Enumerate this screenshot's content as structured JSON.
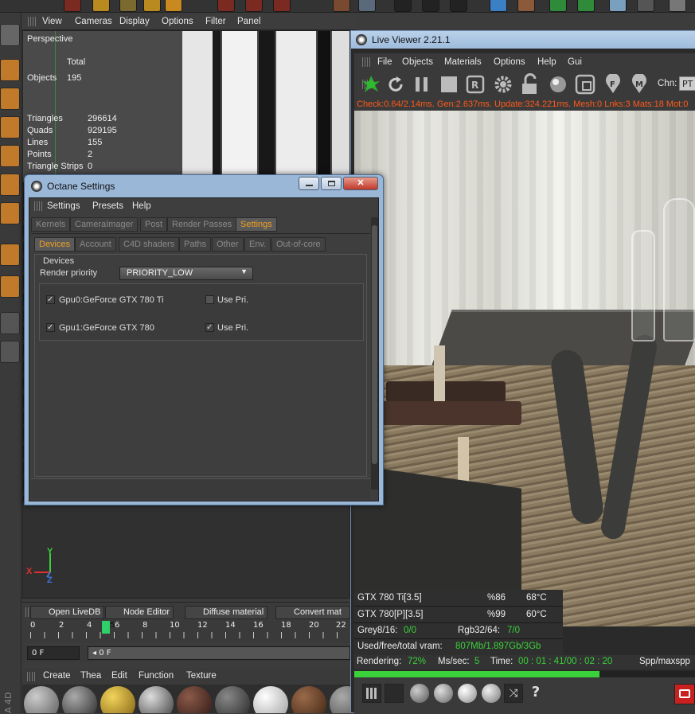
{
  "viewport": {
    "menu": [
      "View",
      "Cameras",
      "Display",
      "Options",
      "Filter",
      "Panel"
    ],
    "label": "Perspective",
    "stats": {
      "total_header": "Total",
      "objects_label": "Objects",
      "objects_value": "195",
      "rows": [
        {
          "label": "Triangles",
          "value": "296614"
        },
        {
          "label": "Quads",
          "value": "929195"
        },
        {
          "label": "Lines",
          "value": "155"
        },
        {
          "label": "Points",
          "value": "2"
        },
        {
          "label": "Triangle Strips",
          "value": "0"
        }
      ]
    },
    "axis": {
      "x": "X",
      "y": "Y",
      "z": "Z"
    }
  },
  "bottom_tabs": [
    "Open LiveDB",
    "Node Editor",
    "Diffuse material",
    "Convert mat"
  ],
  "timeline": {
    "ticks": [
      "0",
      "2",
      "4",
      "5",
      "6",
      "8",
      "10",
      "12",
      "14",
      "16",
      "18",
      "20",
      "22"
    ],
    "current_frame": 5,
    "frame_start": "0 F",
    "frame_current": "0 F"
  },
  "material_menu": [
    "Create",
    "Thea",
    "Edit",
    "Function",
    "Texture"
  ],
  "side_label": "A 4D",
  "live_viewer": {
    "title": "Live Viewer 2.21.1",
    "menu": [
      "File",
      "Objects",
      "Materials",
      "Options",
      "Help",
      "Gui"
    ],
    "tool_icons": [
      "render-start-icon",
      "refresh-icon",
      "pause-icon",
      "stop-icon",
      "region-icon",
      "settings-icon",
      "lock-icon",
      "sphere-icon",
      "clay-icon",
      "focus-icon",
      "pick-icon"
    ],
    "channel_label": "Chn:",
    "channel_value": "PT",
    "status_line": "Check:0.64/2.14ms. Gen:2.637ms. Update:324.221ms. Mesh:0 Lnks:3 Mats:18 Mot:0",
    "gpus": [
      {
        "name": "GTX 780 Ti[3.5]",
        "usage": "%86",
        "temp": "68°C"
      },
      {
        "name": "GTX 780[P][3.5]",
        "usage": "%99",
        "temp": "60°C"
      }
    ],
    "grey_label": "Grey8/16:",
    "grey_value": "0/0",
    "rgb_label": "Rgb32/64:",
    "rgb_value": "7/0",
    "vram_label": "Used/free/total vram:",
    "vram_value": "807Mb/1.897Gb/3Gb",
    "rendering_label": "Rendering:",
    "rendering_value": "72%",
    "mssec_label": "Ms/sec:",
    "mssec_value": "5",
    "time_label": "Time:",
    "time_value": "00 : 01 : 41/00 : 02 : 20",
    "spp_label": "Spp/maxspp",
    "progress": 0.72
  },
  "octane": {
    "title": "Octane Settings",
    "menu": [
      "Settings",
      "Presets",
      "Help"
    ],
    "tabs": [
      "Kernels",
      "CameraImager",
      "Post",
      "Render Passes",
      "Settings"
    ],
    "active_tab": "Settings",
    "subtabs": [
      "Devices",
      "Account",
      "C4D shaders",
      "Paths",
      "Other",
      "Env.",
      "Out-of-core"
    ],
    "active_subtab": "Devices",
    "group_title": "Devices",
    "priority_label": "Render priority",
    "priority_value": "PRIORITY_LOW",
    "devices": [
      {
        "name": "Gpu0:GeForce GTX 780 Ti",
        "enabled": true,
        "use_pri_label": "Use Pri.",
        "use_pri": false
      },
      {
        "name": "Gpu1:GeForce GTX 780",
        "enabled": true,
        "use_pri_label": "Use Pri.",
        "use_pri": true
      }
    ]
  },
  "colors": {
    "accent": "#f0a020",
    "status_red": "#ff5a1a",
    "progress_green": "#3ad13a",
    "value_green": "#3ad13a"
  }
}
